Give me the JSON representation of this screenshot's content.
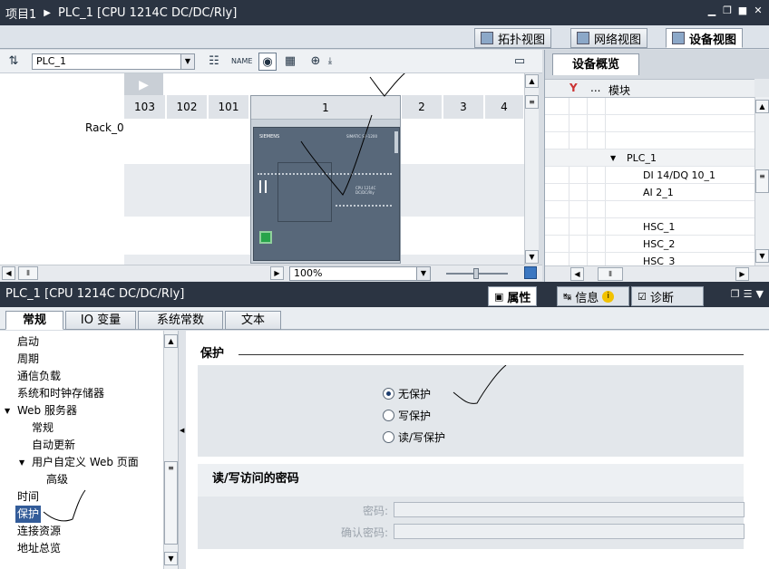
{
  "portal_title": {
    "project": "项目1",
    "device": "PLC_1 [CPU 1214C DC/DC/Rly]"
  },
  "view_tabs": [
    {
      "label": "拓扑视图"
    },
    {
      "label": "网络视图"
    },
    {
      "label": "设备视图"
    }
  ],
  "toolbar": {
    "device_select": "PLC_1"
  },
  "rack": {
    "label": "Rack_0",
    "slots": [
      "103",
      "102",
      "101",
      "1",
      "2",
      "3",
      "4"
    ],
    "cpu_brand": "SIEMENS",
    "cpu_model": "SIMATIC S7-1200",
    "cpu_label": "CPU 1214C DC/DC/Rly"
  },
  "zoom": {
    "value": "100%"
  },
  "overview": {
    "tab": "设备概览",
    "column": "模块",
    "rows": [
      "",
      "",
      "",
      "PLC_1",
      "DI 14/DQ 10_1",
      "AI 2_1",
      "",
      "HSC_1",
      "HSC_2",
      "HSC_3"
    ],
    "dots": "..."
  },
  "bottom": {
    "title": "PLC_1 [CPU 1214C DC/DC/Rly]",
    "tabs": [
      {
        "label": "属性"
      },
      {
        "label": "信息"
      },
      {
        "label": "诊断"
      }
    ]
  },
  "prop_tabs": [
    {
      "label": "常规"
    },
    {
      "label": "IO 变量"
    },
    {
      "label": "系统常数"
    },
    {
      "label": "文本"
    }
  ],
  "nav": [
    {
      "label": "启动"
    },
    {
      "label": "周期"
    },
    {
      "label": "通信负载"
    },
    {
      "label": "系统和时钟存储器"
    },
    {
      "label": "Web 服务器"
    },
    {
      "label": "常规"
    },
    {
      "label": "自动更新"
    },
    {
      "label": "用户自定义 Web 页面"
    },
    {
      "label": "高级"
    },
    {
      "label": "时间"
    },
    {
      "label": "保护"
    },
    {
      "label": "连接资源"
    },
    {
      "label": "地址总览"
    }
  ],
  "protection": {
    "title": "保护",
    "options": [
      {
        "label": "无保护",
        "selected": true
      },
      {
        "label": "写保护",
        "selected": false
      },
      {
        "label": "读/写保护",
        "selected": false
      }
    ],
    "pw_title": "读/写访问的密码",
    "pw_label": "密码:",
    "confirm_label": "确认密码:"
  }
}
